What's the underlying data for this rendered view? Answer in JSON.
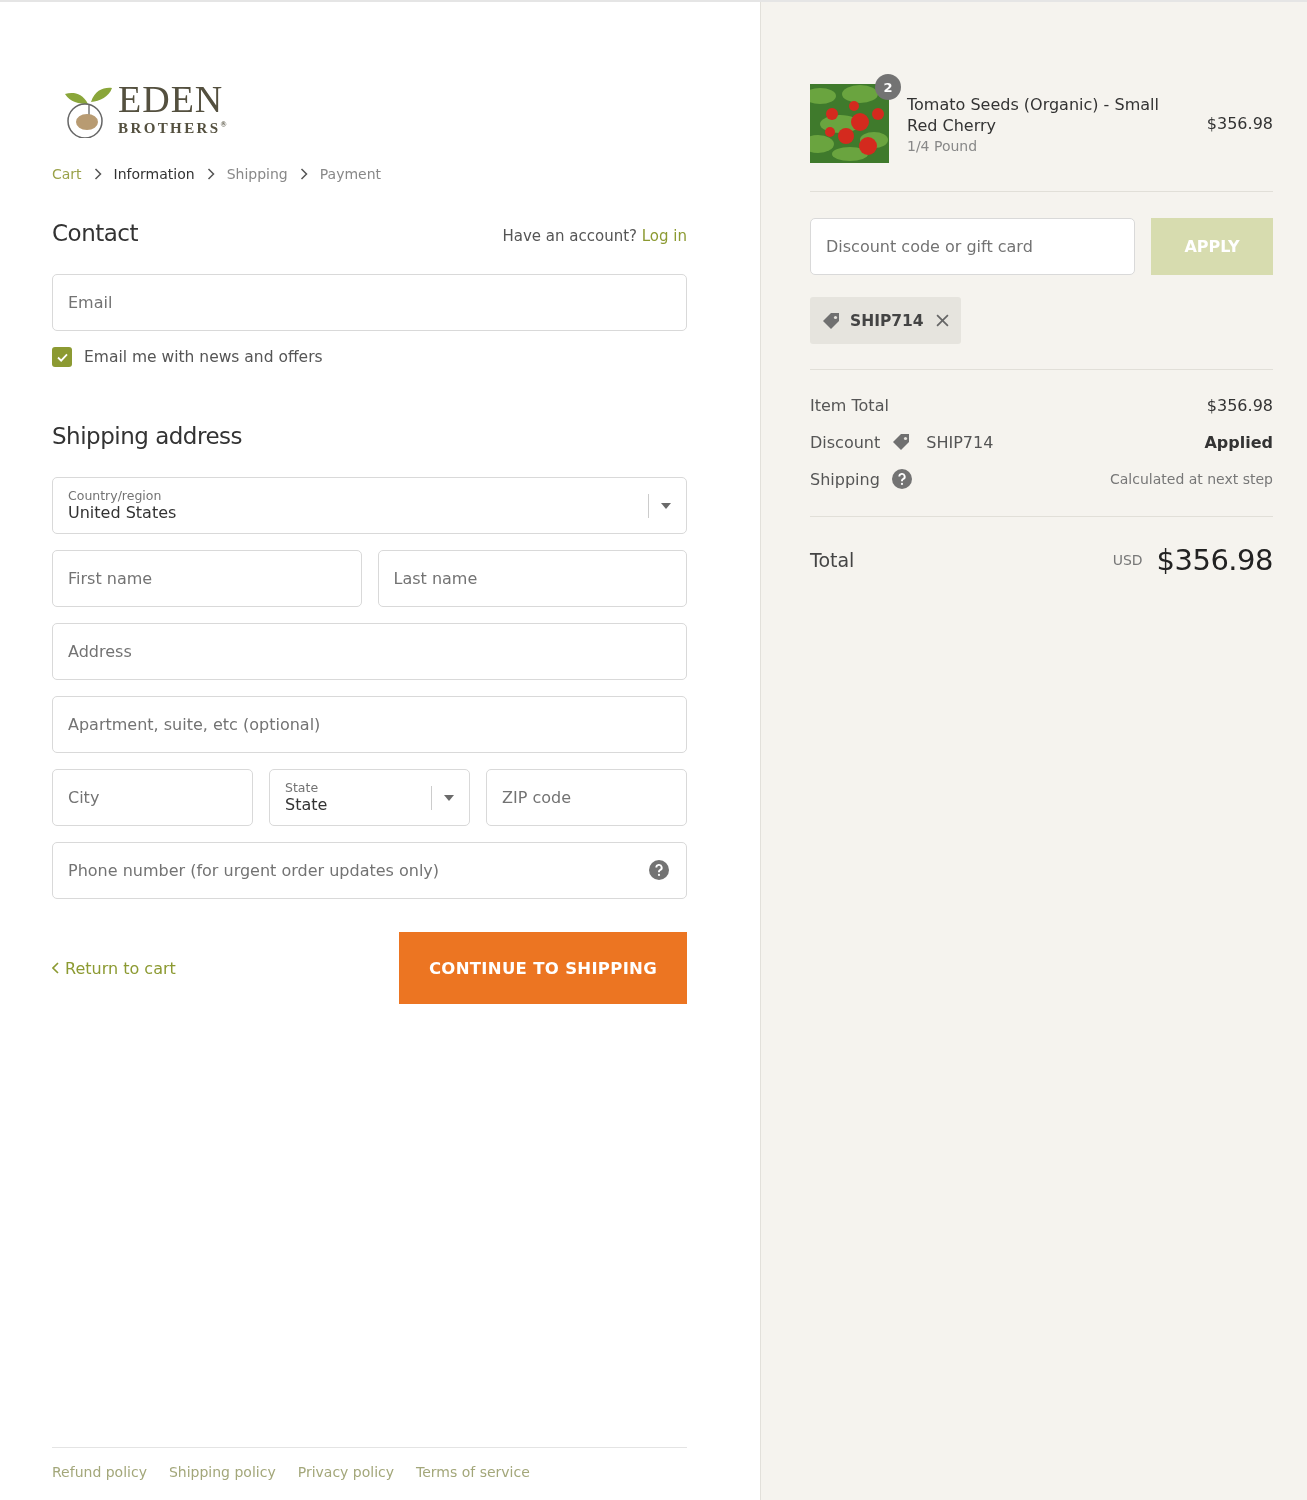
{
  "brand": {
    "name": "EDEN",
    "sub": "BROTHERS$^{®}$"
  },
  "breadcrumb": [
    {
      "label": "Cart",
      "kind": "link"
    },
    {
      "label": "Information",
      "kind": "current"
    },
    {
      "label": "Shipping",
      "kind": "upcoming"
    },
    {
      "label": "Payment",
      "kind": "upcoming"
    }
  ],
  "contact": {
    "title": "Contact",
    "account_prompt": "Have an account?",
    "login_link": "Log in",
    "email": {
      "placeholder": "Email"
    },
    "newsletter": {
      "label": "Email me with news and offers",
      "checked": true
    }
  },
  "shipping_address": {
    "title": "Shipping address",
    "rows": [
      [
        {
          "kind": "select",
          "label": "Country/region",
          "value": "United States"
        }
      ],
      [
        {
          "kind": "text",
          "placeholder": "First name"
        },
        {
          "kind": "text",
          "placeholder": "Last name"
        }
      ],
      [
        {
          "kind": "text",
          "placeholder": "Address"
        }
      ],
      [
        {
          "kind": "text",
          "placeholder": "Apartment, suite, etc (optional)"
        }
      ],
      [
        {
          "kind": "text",
          "placeholder": "City"
        },
        {
          "kind": "select",
          "label": "State",
          "value": "State"
        },
        {
          "kind": "text",
          "placeholder": "ZIP code"
        }
      ],
      [
        {
          "kind": "help",
          "placeholder": "Phone number (for urgent order updates only)"
        }
      ]
    ]
  },
  "actions": {
    "back_link": "Return to cart",
    "continue_button": "CONTINUE TO SHIPPING"
  },
  "footer_links": [
    "Refund policy",
    "Shipping policy",
    "Privacy policy",
    "Terms of service"
  ],
  "order": {
    "item": {
      "quantity": "2",
      "name": "Tomato Seeds (Organic) - Small Red Cherry",
      "variant": "1/4 Pound",
      "price": "$356.98"
    },
    "discount": {
      "placeholder": "Discount code or gift card",
      "apply_button": "APPLY",
      "disabled": true,
      "applied_code": "SHIP714"
    },
    "summary": [
      {
        "kind": "plain",
        "label": "Item Total",
        "value": "$356.98"
      },
      {
        "kind": "discount",
        "label": "Discount",
        "code": "SHIP714",
        "value": "Applied"
      },
      {
        "kind": "help",
        "label": "Shipping",
        "value": "Calculated at next step"
      }
    ],
    "total": {
      "label": "Total",
      "currency": "USD",
      "amount": "$356.98"
    }
  }
}
